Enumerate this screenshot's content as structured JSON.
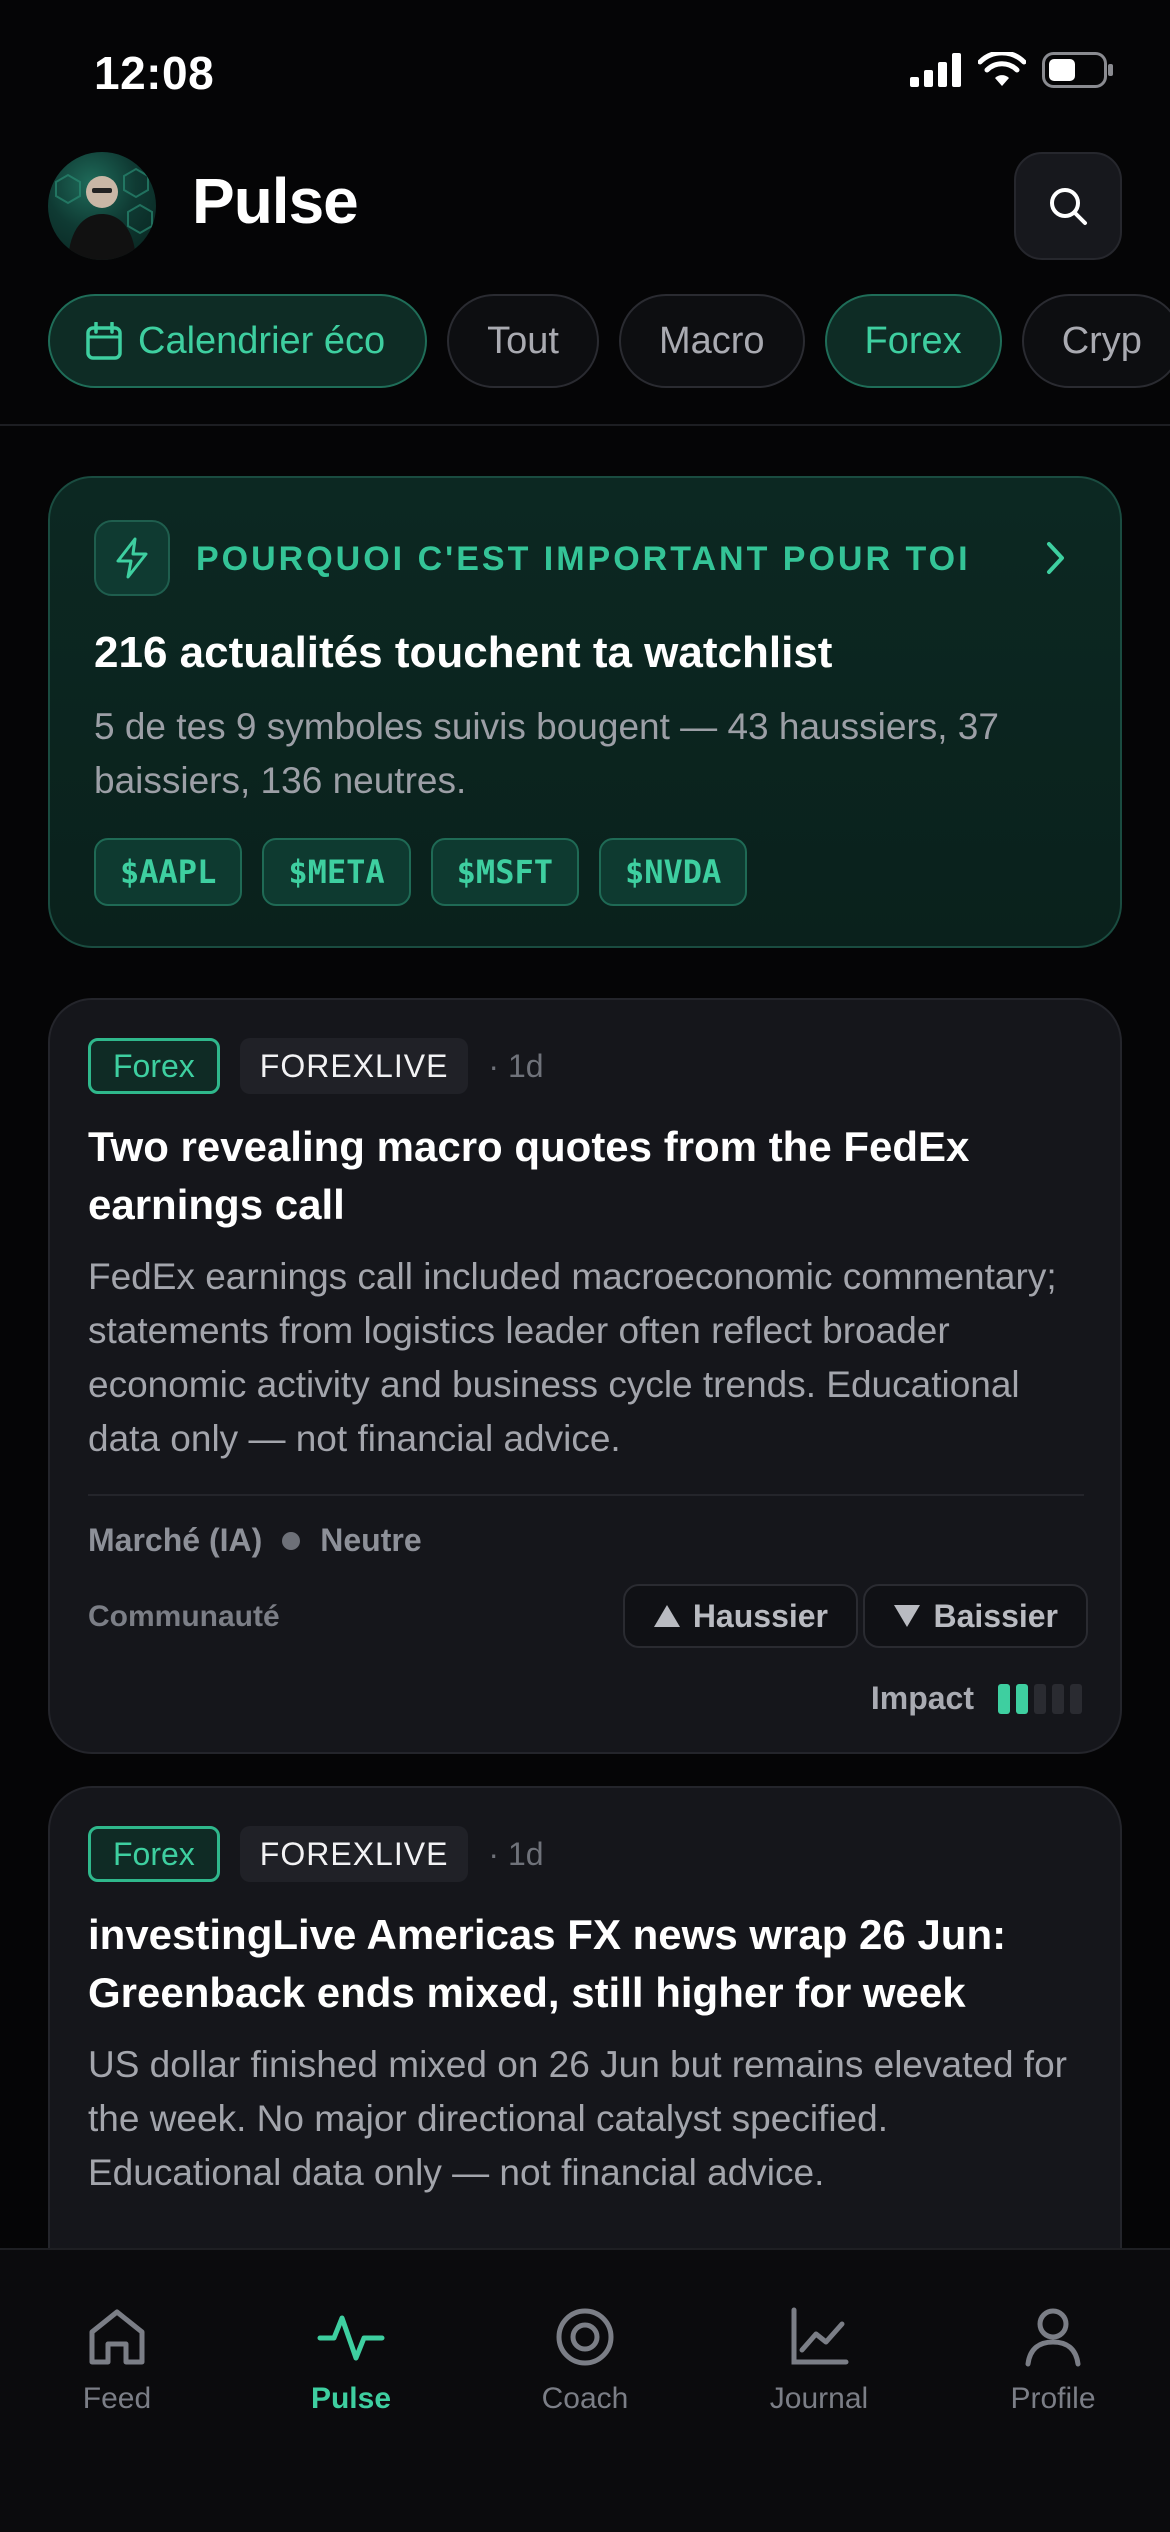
{
  "status": {
    "time": "12:08"
  },
  "header": {
    "title": "Pulse"
  },
  "chips": {
    "eco": "Calendrier éco",
    "items": [
      {
        "label": "Tout",
        "active": false
      },
      {
        "label": "Macro",
        "active": false
      },
      {
        "label": "Forex",
        "active": true
      },
      {
        "label": "Cryp",
        "active": false
      }
    ]
  },
  "watch": {
    "kicker": "POURQUOI C'EST IMPORTANT POUR TOI",
    "title": "216 actualités touchent ta watchlist",
    "subtitle": "5 de tes 9 symboles suivis bougent — 43 haussiers, 37 baissiers, 136 neutres.",
    "tickers": [
      "$AAPL",
      "$META",
      "$MSFT",
      "$NVDA"
    ]
  },
  "cards": [
    {
      "category": "Forex",
      "source": "FOREXLIVE",
      "time": "· 1d",
      "title": "Two revealing macro quotes from the FedEx earnings call",
      "body": "FedEx earnings call included macroeconomic commentary; statements from logistics leader often reflect broader economic activity and business cycle trends. Educational data only — not financial advice.",
      "market_label": "Marché (IA)",
      "market_value": "Neutre",
      "community_label": "Communauté",
      "bull_label": "Haussier",
      "bear_label": "Baissier",
      "impact_label": "Impact",
      "impact_level": 2,
      "impact_max": 5
    },
    {
      "category": "Forex",
      "source": "FOREXLIVE",
      "time": "· 1d",
      "title": "investingLive Americas FX news wrap 26 Jun: Greenback ends mixed, still higher for week",
      "body": "US dollar finished mixed on 26 Jun but remains elevated for the week. No major directional catalyst specified. Educational data only — not financial advice."
    }
  ],
  "tabs": [
    {
      "label": "Feed",
      "icon": "home-icon",
      "active": false
    },
    {
      "label": "Pulse",
      "icon": "pulse-icon",
      "active": true
    },
    {
      "label": "Coach",
      "icon": "target-icon",
      "active": false
    },
    {
      "label": "Journal",
      "icon": "chart-line-icon",
      "active": false
    },
    {
      "label": "Profile",
      "icon": "user-icon",
      "active": false
    }
  ],
  "colors": {
    "accent": "#3ecfa0",
    "background": "#050506",
    "card": "#15161b"
  }
}
